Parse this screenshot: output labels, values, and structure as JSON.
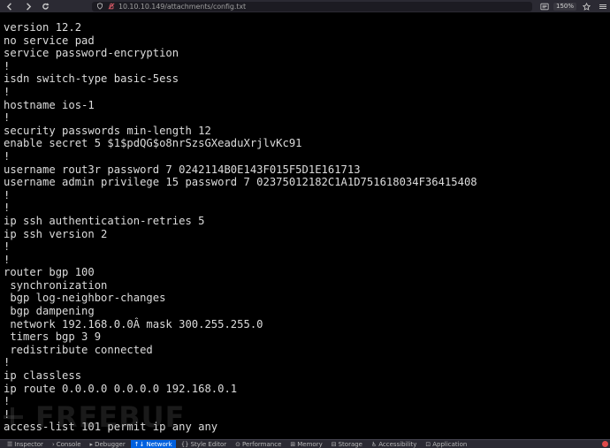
{
  "browser": {
    "url": "10.10.10.149/attachments/config.txt",
    "zoom": "150%"
  },
  "config_text": "version 12.2\nno service pad\nservice password-encryption\n!\nisdn switch-type basic-5ess\n!\nhostname ios-1\n!\nsecurity passwords min-length 12\nenable secret 5 $1$pdQG$o8nrSzsGXeaduXrjlvKc91\n!\nusername rout3r password 7 0242114B0E143F015F5D1E161713\nusername admin privilege 15 password 7 02375012182C1A1D751618034F36415408\n!\n!\nip ssh authentication-retries 5\nip ssh version 2\n!\n!\nrouter bgp 100\n synchronization\n bgp log-neighbor-changes\n bgp dampening\n network 192.168.0.0Â mask 300.255.255.0\n timers bgp 3 9\n redistribute connected\n!\nip classless\nip route 0.0.0.0 0.0.0.0 192.168.0.1\n!\n!\naccess-list 101 permit ip any any",
  "watermark": "FREEBUF",
  "devtools": {
    "tabs": [
      {
        "icon": "☰",
        "label": "Inspector"
      },
      {
        "icon": "›",
        "label": "Console"
      },
      {
        "icon": "▸",
        "label": "Debugger"
      },
      {
        "icon": "↑↓",
        "label": "Network"
      },
      {
        "icon": "{}",
        "label": "Style Editor"
      },
      {
        "icon": "⊙",
        "label": "Performance"
      },
      {
        "icon": "⊞",
        "label": "Memory"
      },
      {
        "icon": "⊟",
        "label": "Storage"
      },
      {
        "icon": "♿",
        "label": "Accessibility"
      },
      {
        "icon": "⊡",
        "label": "Application"
      }
    ],
    "active": "Network"
  }
}
